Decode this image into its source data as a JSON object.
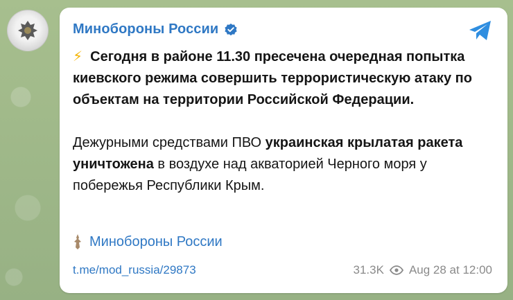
{
  "channel": {
    "name": "Минобороны России"
  },
  "post": {
    "lightning_icon": "⚡",
    "lead_paragraph": "Сегодня в районе 11.30 пресечена очередная попытка киевского режима совершить террористическую атаку по объектам на территории Российской Федерации.",
    "body_part1": "Дежурными средствами ПВО ",
    "body_bold": "украинская крылатая ракета уничтожена",
    "body_part2": " в воздухе над акваторией Черного моря у побережья Республики Крым."
  },
  "signature": {
    "icon": "emblem-icon",
    "label": "Минобороны России"
  },
  "footer": {
    "link": "t.me/mod_russia/29873",
    "views": "31.3K",
    "timestamp": "Aug 28 at 12:00"
  },
  "colors": {
    "accent": "#2f78c4",
    "text": "#151515",
    "meta": "#8a8a8a",
    "background": "#9fb98a",
    "bubble": "#ffffff"
  }
}
